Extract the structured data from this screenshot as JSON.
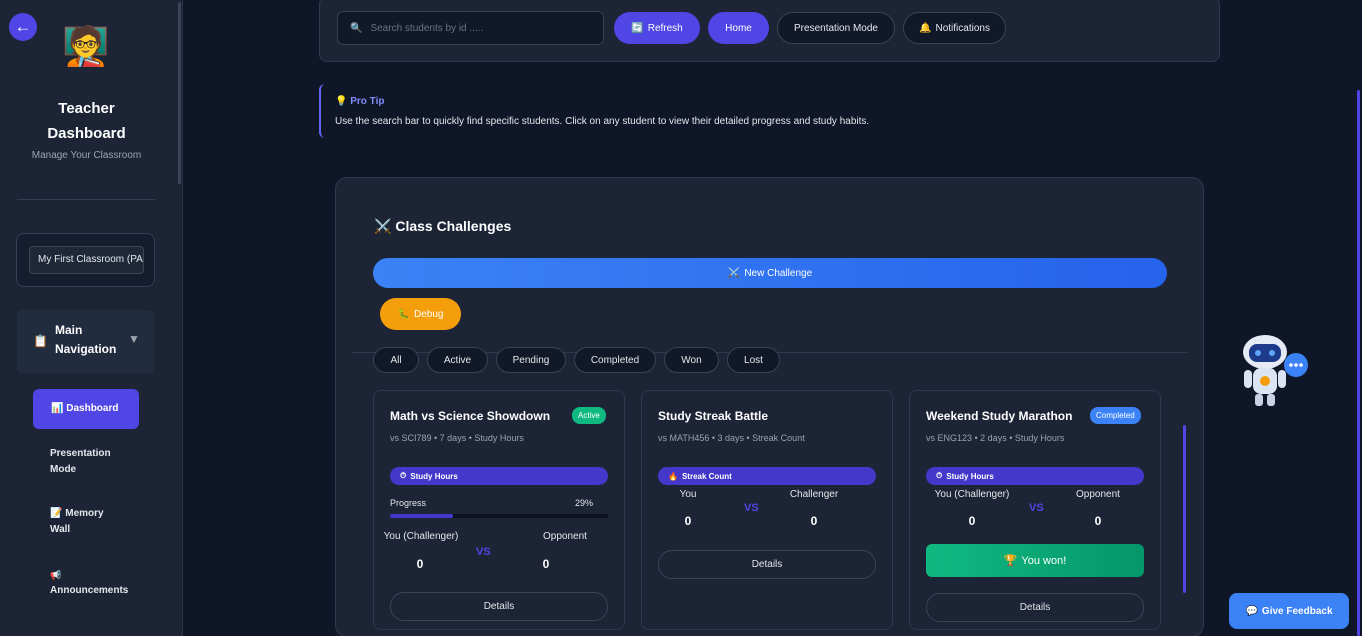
{
  "sidebar": {
    "back_icon": "←",
    "avatar_icon": "🧑‍🏫",
    "title": "Teacher Dashboard",
    "subtitle": "Manage Your Classroom",
    "classroom": "My First Classroom (PAI",
    "main_nav_icon": "📋",
    "main_nav_label": "Main Navigation",
    "main_nav_caret": "▼",
    "items": [
      {
        "icon": "📊",
        "label": "Dashboard"
      },
      {
        "icon": "",
        "label": "Presentation Mode"
      },
      {
        "icon": "📝",
        "label": "Memory Wall"
      },
      {
        "icon": "📢",
        "label": "Announcements"
      }
    ]
  },
  "topbar": {
    "search_icon": "🔍",
    "search_placeholder": "Search students by id .....",
    "refresh_icon": "🔄",
    "refresh": "Refresh",
    "home": "Home",
    "presentation_mode": "Presentation Mode",
    "notifications_icon": "🔔",
    "notifications": "Notifications"
  },
  "protip": {
    "icon": "💡",
    "title": "Pro Tip",
    "text": "Use the search bar to quickly find specific students. Click on any student to view their detailed progress and study habits."
  },
  "challenges": {
    "title_icon": "⚔️",
    "title": "Class Challenges",
    "new_icon": "⚔️",
    "new_label": "New Challenge",
    "debug_icon": "🐛",
    "debug_label": "Debug",
    "filters": [
      "All",
      "Active",
      "Pending",
      "Completed",
      "Won",
      "Lost"
    ],
    "vs_label": "VS",
    "details_label": "Details",
    "cards": [
      {
        "title": "Math vs Science Showdown",
        "meta": "vs SCI789 • 7 days • Study Hours",
        "status": "Active",
        "status_color": "#10b981",
        "metric_icon": "⏱",
        "metric": "Study Hours",
        "progress_label": "Progress",
        "progress_value": "29%",
        "progress": 0.29,
        "left_label": "You (Challenger)",
        "right_label": "Opponent",
        "left_score": "0",
        "right_score": "0"
      },
      {
        "title": "Study Streak Battle",
        "meta": "vs MATH456 • 3 days • Streak Count",
        "status": "",
        "metric_icon": "🔥",
        "metric": "Streak Count",
        "left_label": "You",
        "right_label": "Challenger",
        "left_score": "0",
        "right_score": "0"
      },
      {
        "title": "Weekend Study Marathon",
        "meta": "vs ENG123 • 2 days • Study Hours",
        "status": "Completed",
        "status_color": "#3b82f6",
        "metric_icon": "⏱",
        "metric": "Study Hours",
        "left_label": "You (Challenger)",
        "right_label": "Opponent",
        "left_score": "0",
        "right_score": "0",
        "result_icon": "🏆",
        "result": "You won!"
      }
    ]
  },
  "feedback": {
    "icon": "💬",
    "label": "Give Feedback"
  },
  "colors": {
    "accent": "#4f46e5",
    "success": "#10b981",
    "warning": "#f59e0b",
    "info": "#3b82f6"
  }
}
